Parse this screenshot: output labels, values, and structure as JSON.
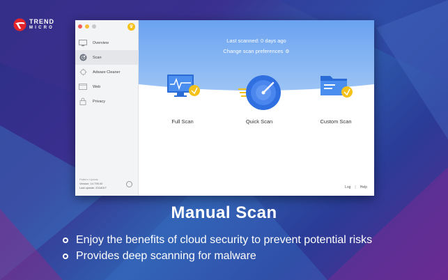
{
  "brand": {
    "name_line1": "TREND",
    "name_line2": "MICRO"
  },
  "window": {
    "sidebar": {
      "items": [
        {
          "label": "Overview",
          "icon": "monitor-icon"
        },
        {
          "label": "Scan",
          "icon": "scan-icon",
          "active": true
        },
        {
          "label": "Adware Cleaner",
          "icon": "adware-icon"
        },
        {
          "label": "Web",
          "icon": "web-icon"
        },
        {
          "label": "Privacy",
          "icon": "lock-icon"
        }
      ],
      "pattern_update": {
        "title": "Pattern Update",
        "version": "Version: 14.795.00",
        "last_update": "Last update: 2018/3/7"
      }
    },
    "main": {
      "last_scanned": "Last scanned: 0 days ago",
      "change_prefs": "Change scan preferences",
      "options": [
        {
          "label": "Full Scan",
          "icon": "full-scan-icon"
        },
        {
          "label": "Quick Scan",
          "icon": "quick-scan-icon"
        },
        {
          "label": "Custom Scan",
          "icon": "custom-scan-icon"
        }
      ],
      "footer": {
        "log": "Log",
        "separator": "|",
        "help": "Help"
      }
    }
  },
  "marketing": {
    "headline": "Manual Scan",
    "bullets": [
      "Enjoy the benefits of cloud security to prevent potential risks",
      "Provides deep scanning for malware"
    ]
  },
  "colors": {
    "accent_blue": "#3f7fe0",
    "hero_top": "#6aa2f0",
    "hero_bottom": "#9cc4f5",
    "brand_red": "#e3232a",
    "badge_yellow": "#f5c21b"
  }
}
